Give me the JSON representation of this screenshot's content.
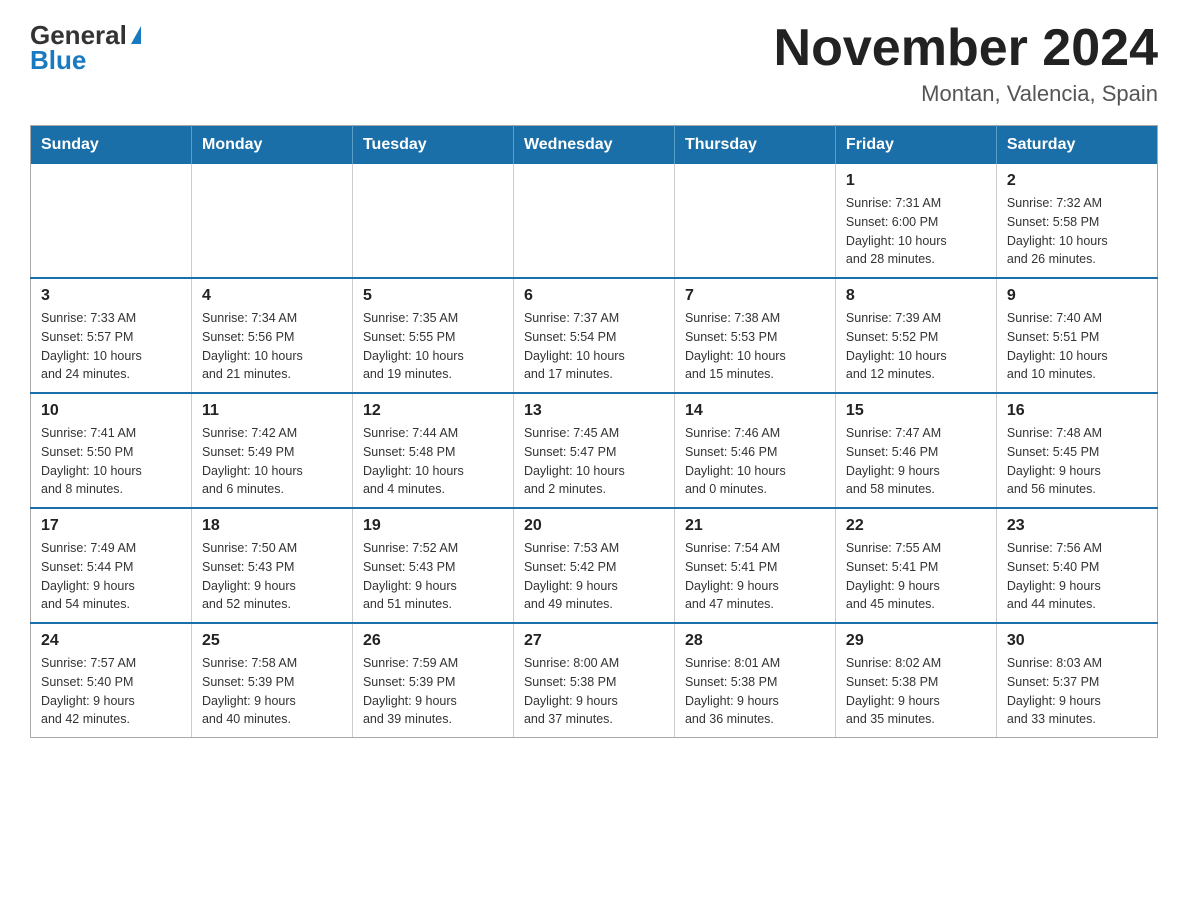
{
  "logo": {
    "general": "General",
    "blue": "Blue"
  },
  "title": "November 2024",
  "subtitle": "Montan, Valencia, Spain",
  "days_of_week": [
    "Sunday",
    "Monday",
    "Tuesday",
    "Wednesday",
    "Thursday",
    "Friday",
    "Saturday"
  ],
  "weeks": [
    [
      {
        "day": "",
        "info": ""
      },
      {
        "day": "",
        "info": ""
      },
      {
        "day": "",
        "info": ""
      },
      {
        "day": "",
        "info": ""
      },
      {
        "day": "",
        "info": ""
      },
      {
        "day": "1",
        "info": "Sunrise: 7:31 AM\nSunset: 6:00 PM\nDaylight: 10 hours\nand 28 minutes."
      },
      {
        "day": "2",
        "info": "Sunrise: 7:32 AM\nSunset: 5:58 PM\nDaylight: 10 hours\nand 26 minutes."
      }
    ],
    [
      {
        "day": "3",
        "info": "Sunrise: 7:33 AM\nSunset: 5:57 PM\nDaylight: 10 hours\nand 24 minutes."
      },
      {
        "day": "4",
        "info": "Sunrise: 7:34 AM\nSunset: 5:56 PM\nDaylight: 10 hours\nand 21 minutes."
      },
      {
        "day": "5",
        "info": "Sunrise: 7:35 AM\nSunset: 5:55 PM\nDaylight: 10 hours\nand 19 minutes."
      },
      {
        "day": "6",
        "info": "Sunrise: 7:37 AM\nSunset: 5:54 PM\nDaylight: 10 hours\nand 17 minutes."
      },
      {
        "day": "7",
        "info": "Sunrise: 7:38 AM\nSunset: 5:53 PM\nDaylight: 10 hours\nand 15 minutes."
      },
      {
        "day": "8",
        "info": "Sunrise: 7:39 AM\nSunset: 5:52 PM\nDaylight: 10 hours\nand 12 minutes."
      },
      {
        "day": "9",
        "info": "Sunrise: 7:40 AM\nSunset: 5:51 PM\nDaylight: 10 hours\nand 10 minutes."
      }
    ],
    [
      {
        "day": "10",
        "info": "Sunrise: 7:41 AM\nSunset: 5:50 PM\nDaylight: 10 hours\nand 8 minutes."
      },
      {
        "day": "11",
        "info": "Sunrise: 7:42 AM\nSunset: 5:49 PM\nDaylight: 10 hours\nand 6 minutes."
      },
      {
        "day": "12",
        "info": "Sunrise: 7:44 AM\nSunset: 5:48 PM\nDaylight: 10 hours\nand 4 minutes."
      },
      {
        "day": "13",
        "info": "Sunrise: 7:45 AM\nSunset: 5:47 PM\nDaylight: 10 hours\nand 2 minutes."
      },
      {
        "day": "14",
        "info": "Sunrise: 7:46 AM\nSunset: 5:46 PM\nDaylight: 10 hours\nand 0 minutes."
      },
      {
        "day": "15",
        "info": "Sunrise: 7:47 AM\nSunset: 5:46 PM\nDaylight: 9 hours\nand 58 minutes."
      },
      {
        "day": "16",
        "info": "Sunrise: 7:48 AM\nSunset: 5:45 PM\nDaylight: 9 hours\nand 56 minutes."
      }
    ],
    [
      {
        "day": "17",
        "info": "Sunrise: 7:49 AM\nSunset: 5:44 PM\nDaylight: 9 hours\nand 54 minutes."
      },
      {
        "day": "18",
        "info": "Sunrise: 7:50 AM\nSunset: 5:43 PM\nDaylight: 9 hours\nand 52 minutes."
      },
      {
        "day": "19",
        "info": "Sunrise: 7:52 AM\nSunset: 5:43 PM\nDaylight: 9 hours\nand 51 minutes."
      },
      {
        "day": "20",
        "info": "Sunrise: 7:53 AM\nSunset: 5:42 PM\nDaylight: 9 hours\nand 49 minutes."
      },
      {
        "day": "21",
        "info": "Sunrise: 7:54 AM\nSunset: 5:41 PM\nDaylight: 9 hours\nand 47 minutes."
      },
      {
        "day": "22",
        "info": "Sunrise: 7:55 AM\nSunset: 5:41 PM\nDaylight: 9 hours\nand 45 minutes."
      },
      {
        "day": "23",
        "info": "Sunrise: 7:56 AM\nSunset: 5:40 PM\nDaylight: 9 hours\nand 44 minutes."
      }
    ],
    [
      {
        "day": "24",
        "info": "Sunrise: 7:57 AM\nSunset: 5:40 PM\nDaylight: 9 hours\nand 42 minutes."
      },
      {
        "day": "25",
        "info": "Sunrise: 7:58 AM\nSunset: 5:39 PM\nDaylight: 9 hours\nand 40 minutes."
      },
      {
        "day": "26",
        "info": "Sunrise: 7:59 AM\nSunset: 5:39 PM\nDaylight: 9 hours\nand 39 minutes."
      },
      {
        "day": "27",
        "info": "Sunrise: 8:00 AM\nSunset: 5:38 PM\nDaylight: 9 hours\nand 37 minutes."
      },
      {
        "day": "28",
        "info": "Sunrise: 8:01 AM\nSunset: 5:38 PM\nDaylight: 9 hours\nand 36 minutes."
      },
      {
        "day": "29",
        "info": "Sunrise: 8:02 AM\nSunset: 5:38 PM\nDaylight: 9 hours\nand 35 minutes."
      },
      {
        "day": "30",
        "info": "Sunrise: 8:03 AM\nSunset: 5:37 PM\nDaylight: 9 hours\nand 33 minutes."
      }
    ]
  ]
}
